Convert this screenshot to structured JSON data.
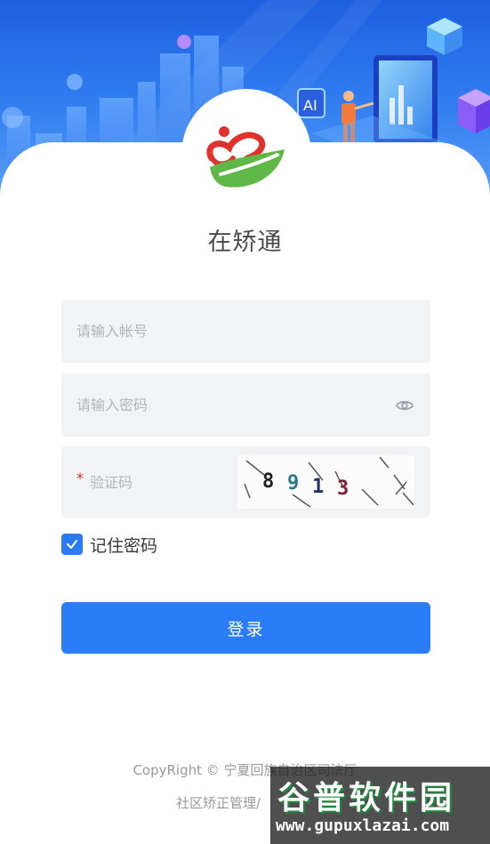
{
  "app": {
    "title": "在矫通"
  },
  "form": {
    "account_placeholder": "请输入帐号",
    "password_placeholder": "请输入密码",
    "captcha_placeholder": "验证码",
    "captcha_required_mark": "*",
    "captcha_code": [
      "8",
      "9",
      "1",
      "3"
    ],
    "remember_label": "记住密码",
    "remember_checked": true,
    "login_label": "登录"
  },
  "footer": {
    "copyright": "CopyRight © 宁夏回族自治区司法厅",
    "system_name": "社区矫正管理/"
  },
  "watermark": {
    "title": "谷普软件园",
    "url": "www.gupuxlazai.com"
  },
  "colors": {
    "primary": "#2b7cf7",
    "hero_dark": "#1e5fe0",
    "field_bg": "#f2f3f5",
    "required": "#e02a2a",
    "logo_red": "#e0322c",
    "logo_green": "#5fb845"
  },
  "icons": {
    "password_toggle": "eye-icon",
    "checkbox": "check-icon",
    "logo": "app-logo"
  }
}
